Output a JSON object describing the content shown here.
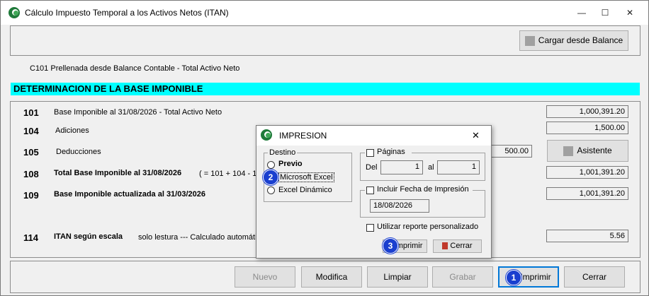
{
  "window": {
    "title": "Cálculo Impuesto Temporal a los Activos Netos (ITAN)",
    "minimize": "—",
    "maximize": "☐",
    "close": "✕"
  },
  "top": {
    "load_button": "Cargar desde Balance",
    "note": "C101 Prellenada desde Balance Contable - Total Activo Neto",
    "banner": "DETERMINACION DE LA BASE IMPONIBLE"
  },
  "rows": [
    {
      "code": "101",
      "label": "Base Imponible al 31/08/2026 - Total Activo Neto",
      "value": "1,000,391.20"
    },
    {
      "code": "104",
      "label": "Adiciones",
      "value": "1,500.00"
    },
    {
      "code": "105",
      "label": "Deducciones",
      "value": "500.00"
    },
    {
      "code": "108",
      "label": "Total Base Imponible al 31/08/2026",
      "formula": "( = 101 + 104 - 10",
      "value": "1,001,391.20"
    },
    {
      "code": "109",
      "label": "Base Imponible actualizada al 31/03/2026",
      "value": "1,001,391.20"
    },
    {
      "code": "114",
      "label": "ITAN según escala",
      "note": "solo lestura --- Calculado automátic",
      "value": "5.56"
    }
  ],
  "assistant_button": "Asistente",
  "footer": {
    "nuevo": "Nuevo",
    "modifica": "Modifica",
    "limpiar": "Limpiar",
    "grabar": "Grabar",
    "imprimir": "Imprimir",
    "cerrar": "Cerrar"
  },
  "dialog": {
    "title": "IMPRESION",
    "close": "✕",
    "destino_label": "Destino",
    "options": [
      "Previo",
      "Microsoft Excel",
      "Excel Dinámico"
    ],
    "paginas_label": "Páginas",
    "del_label": "Del",
    "del_value": "1",
    "al_label": "al",
    "al_value": "1",
    "fecha_label": "Incluir Fecha de Impresión",
    "fecha_value": "18/08/2026",
    "personalizado_label": "Utilizar reporte personalizado",
    "imprimir": "Imprimir",
    "cerrar": "Cerrar"
  },
  "badges": [
    "1",
    "2",
    "3"
  ],
  "colors": {
    "banner": "#00ffff",
    "badge": "#1a3fcf",
    "focus": "#0078d7"
  }
}
